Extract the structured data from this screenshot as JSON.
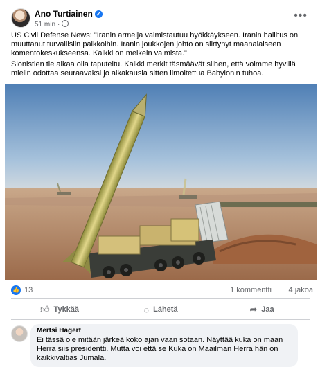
{
  "post": {
    "author": "Ano Turtiainen",
    "time": "51 min",
    "separator": "·",
    "more_label": "•••",
    "text1": "US Civil Defense News: \"Iranin armeija valmistautuu hyökkäykseen. Iranin hallitus on muuttanut turvallisiin paikkoihin. Iranin joukkojen johto on siirtynyt maanalaiseen komentokeskukseensa. Kaikki on melkein valmista.\"",
    "text2": "Sionistien tie alkaa olla taputeltu. Kaikki merkit täsmäävät siihen, että voimme hyvillä mielin odottaa seuraavaksi jo aikakausia sitten ilmoitettua Babylonin tuhoa."
  },
  "stats": {
    "likes": "13",
    "comments": "1 kommentti",
    "shares": "4 jakoa"
  },
  "actions": {
    "like": "Tykkää",
    "send": "Lähetä",
    "share": "Jaa"
  },
  "comment": {
    "author": "Mertsi Hagert",
    "text": "Ei tässä ole mitään järkeä koko ajan vaan sotaan. Näyttää kuka on maan Herra siis presidentti. Mutta voi että se Kuka on Maailman Herra hän on kaikkivaltias Jumala."
  },
  "colors": {
    "accent": "#1877f2",
    "muted_text": "#65676b",
    "comment_bg": "#f0f2f5"
  },
  "icons": {
    "verified": "check-badge",
    "globe": "globe-icon",
    "like": "thumbs-up-icon",
    "send": "messenger-icon",
    "share": "share-arrow-icon"
  }
}
